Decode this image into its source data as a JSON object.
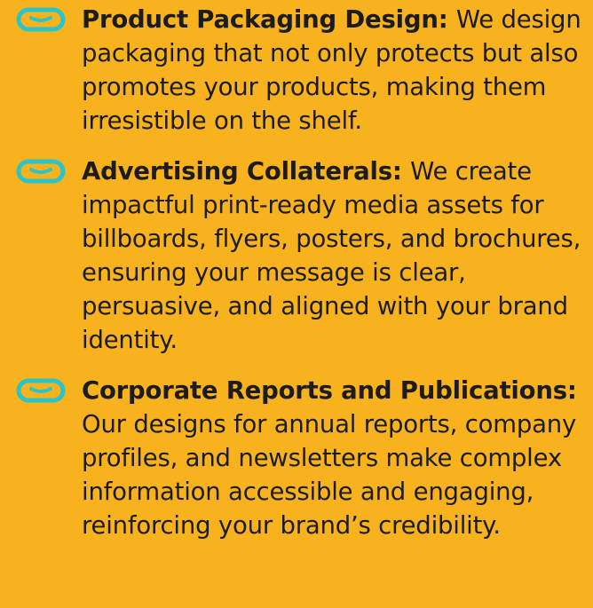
{
  "services": [
    {
      "icon": "infinity-loop-icon",
      "title": "Product Packaging Design:",
      "description": "We design packaging that not only protects but also promotes your products, making them irresistible on the shelf."
    },
    {
      "icon": "infinity-loop-icon",
      "title": "Advertising Collaterals:",
      "description": "We create impactful print-ready media assets for billboards, flyers, posters, and brochures, ensuring your message is clear, persuasive, and aligned with your brand identity."
    },
    {
      "icon": "infinity-loop-icon",
      "title": "Corporate Reports and Publications:",
      "description": "Our designs for annual reports, company profiles, and newsletters make complex information accessible and engaging, reinforcing your brand’s credibility."
    }
  ],
  "colors": {
    "background": "#F8B21E",
    "icon": "#2BC4C9",
    "text": "#1c1c1c"
  }
}
